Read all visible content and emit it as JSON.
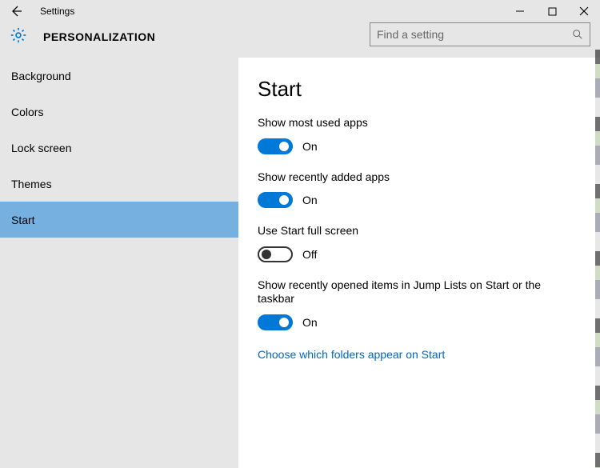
{
  "window": {
    "title": "Settings"
  },
  "header": {
    "section": "PERSONALIZATION"
  },
  "search": {
    "placeholder": "Find a setting"
  },
  "sidebar": {
    "items": [
      {
        "label": "Background",
        "selected": false
      },
      {
        "label": "Colors",
        "selected": false
      },
      {
        "label": "Lock screen",
        "selected": false
      },
      {
        "label": "Themes",
        "selected": false
      },
      {
        "label": "Start",
        "selected": true
      }
    ]
  },
  "main": {
    "title": "Start",
    "settings": [
      {
        "label": "Show most used apps",
        "on": true
      },
      {
        "label": "Show recently added apps",
        "on": true
      },
      {
        "label": "Use Start full screen",
        "on": false
      },
      {
        "label": "Show recently opened items in Jump Lists on Start or the taskbar",
        "on": true
      }
    ],
    "state_on": "On",
    "state_off": "Off",
    "link": "Choose which folders appear on Start"
  }
}
